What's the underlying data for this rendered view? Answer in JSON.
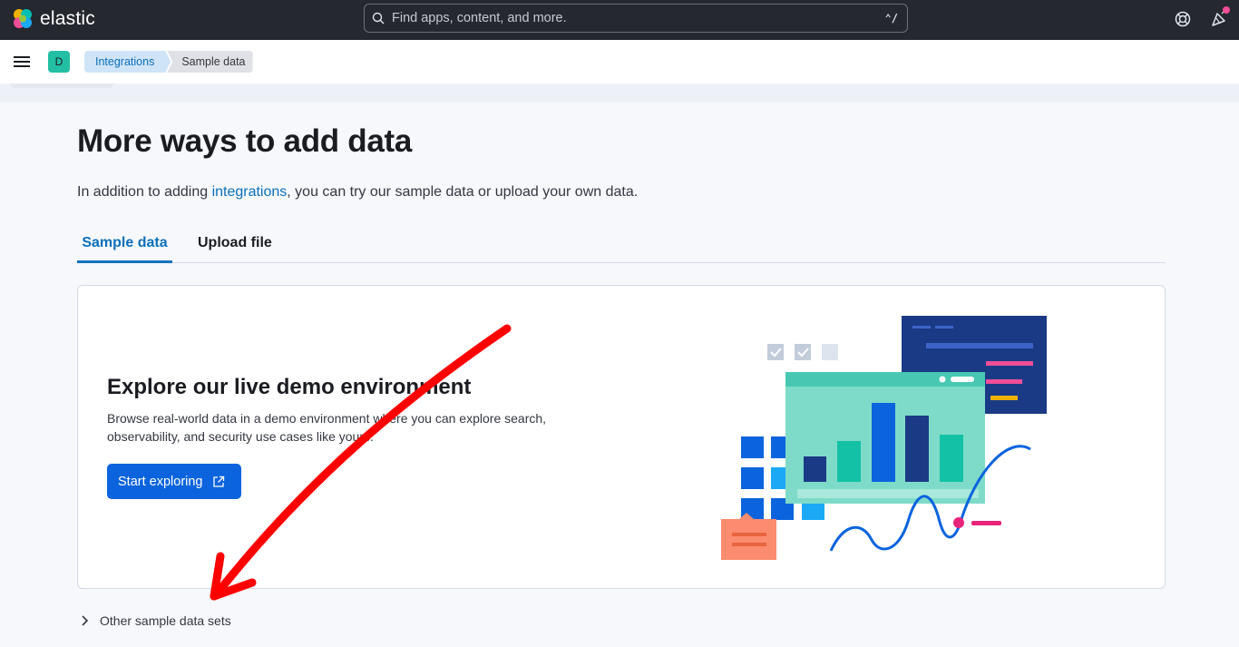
{
  "header": {
    "brand": "elastic",
    "search_placeholder": "Find apps, content, and more.",
    "search_shortcut": "⌃/"
  },
  "subheader": {
    "space_initial": "D",
    "breadcrumbs": [
      "Integrations",
      "Sample data"
    ]
  },
  "main": {
    "title": "More ways to add data",
    "intro_before": "In addition to adding ",
    "intro_link": "integrations",
    "intro_after": ", you can try our sample data or upload your own data.",
    "tabs": [
      {
        "label": "Sample data",
        "active": true
      },
      {
        "label": "Upload file",
        "active": false
      }
    ],
    "demo": {
      "title": "Explore our live demo environment",
      "text": "Browse real-world data in a demo environment where you can explore search, observability, and security use cases like yours.",
      "button_label": "Start exploring"
    },
    "accordion_label": "Other sample data sets"
  },
  "icons": {
    "logo": "elastic-logo-icon",
    "search": "search-icon",
    "help": "help-lifebuoy-icon",
    "news": "newsfeed-icon",
    "menu": "hamburger-menu-icon",
    "external": "external-link-icon",
    "chevron": "chevron-right-icon"
  },
  "colors": {
    "brand_blue": "#0b64dd",
    "link_blue": "#0a6fba",
    "header_bg": "#25282f",
    "annotation_red": "#ff0000",
    "space_avatar": "#23bfa4"
  }
}
